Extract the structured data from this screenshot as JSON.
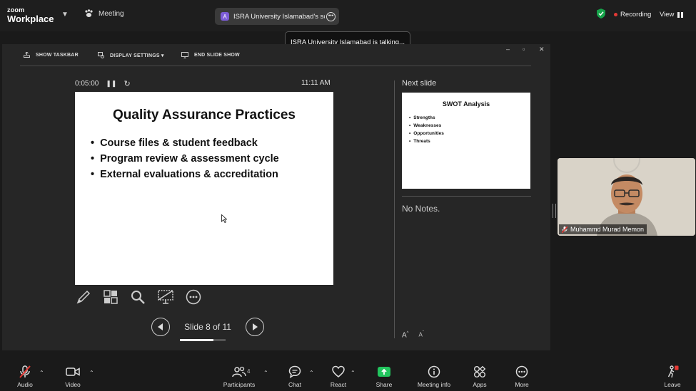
{
  "topbar": {
    "logo_small": "zoom",
    "logo_big": "Workplace",
    "meeting_label": "Meeting",
    "screen_tab_initial": "A",
    "screen_tab_label": "ISRA University Islamabad's screen",
    "recording_label": "Recording",
    "view_label": "View"
  },
  "toast": {
    "text": "ISRA University Islamabad is talking..."
  },
  "presenter_toolbar": {
    "show_taskbar": "SHOW TASKBAR",
    "display_settings": "DISPLAY SETTINGS ▾",
    "end_slide_show": "END SLIDE SHOW"
  },
  "presenter": {
    "timer": "0:05:00",
    "clock": "11:11 AM",
    "slide_counter": "Slide 8 of 11",
    "slide_progress": 0.73,
    "next_slide_label": "Next slide",
    "notes": "No Notes."
  },
  "current_slide": {
    "title": "Quality Assurance Practices",
    "bullets": [
      "Course files & student feedback",
      "Program review & assessment cycle",
      "External evaluations & accreditation"
    ]
  },
  "next_slide": {
    "title": "SWOT Analysis",
    "bullets": [
      "Strengths",
      "Weaknesses",
      "Opportunities",
      "Threats"
    ]
  },
  "participant": {
    "name": "Muhammd Murad Memon"
  },
  "bottombar": {
    "audio": "Audio",
    "video": "Video",
    "participants": "Participants",
    "participants_count": "4",
    "chat": "Chat",
    "react": "React",
    "share": "Share",
    "meeting_info": "Meeting info",
    "apps": "Apps",
    "more": "More",
    "leave": "Leave"
  },
  "colors": {
    "share_green": "#22c55e",
    "recording_red": "#e53935",
    "shield_green": "#16a34a",
    "leave_red": "#e53935"
  }
}
